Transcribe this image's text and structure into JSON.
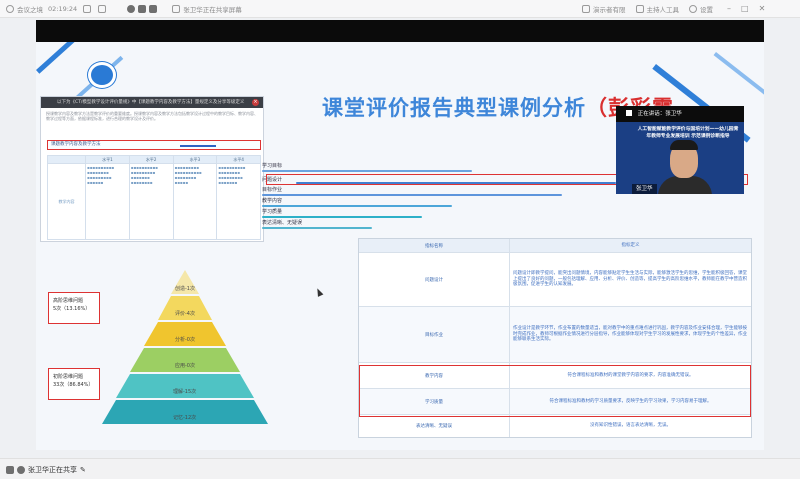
{
  "topbar": {
    "status_text": "会议之境",
    "time_text": "02:19:24",
    "sharing_text": "张卫华正在共享屏幕",
    "menu_items": [
      "演示者有限",
      "主持人工具",
      "设置"
    ]
  },
  "slide": {
    "title": "课堂评价报告典型课例分析",
    "title_paren_open": "（",
    "title_name": "彭彩霞"
  },
  "document": {
    "header": "以下为《CT/模型教学设计评价量规》中【课题教学内容及教学方法】量规定义及分享等级定义",
    "paragraph": "授课教学内容及教学方法是教学评价的重要维度。授课教学内容及教学方法包括教学设计过程中的教学目标、教学内容、教学过程等方面，依据课程标准，进行合理的教学设计及评价。",
    "banner": "课题教学内容及教学方法",
    "columns": [
      "",
      "水平1",
      "水平2",
      "水平3",
      "水平4"
    ],
    "row_label": "教学内容"
  },
  "labels": {
    "high_order_title": "高阶思维问题",
    "high_order_value": "5次（13.16%）",
    "low_order_title": "初阶思维问题",
    "low_order_value": "33次（86.84%）"
  },
  "pyramid": [
    {
      "label": "创造-1次",
      "color": "#f5e7a9"
    },
    {
      "label": "评价-4次",
      "color": "#f3d85e"
    },
    {
      "label": "分析-0次",
      "color": "#f0c52e"
    },
    {
      "label": "应用-0次",
      "color": "#9ccf63"
    },
    {
      "label": "理解-15次",
      "color": "#4fc3c4"
    },
    {
      "label": "记忆-12次",
      "color": "#2ca6b4"
    }
  ],
  "criteria": [
    {
      "label": "学习目标",
      "color": "#6aa3e0",
      "highlight": false
    },
    {
      "label": "问题设计",
      "color": "#3f7fd1",
      "highlight": true
    },
    {
      "label": "目标作业",
      "color": "#5d95dc",
      "highlight": false
    },
    {
      "label": "教学内容",
      "color": "#4ca6d9",
      "highlight": false
    },
    {
      "label": "学习质量",
      "color": "#2db0c8",
      "highlight": false
    },
    {
      "label": "表达清晰、无疑误",
      "color": "#52b5cf",
      "highlight": false
    }
  ],
  "table": {
    "header_left": "指标名称",
    "header_right": "指标定义",
    "rows": [
      {
        "name": "问题设计",
        "def": "问题设计即教学提问，能突出问题情境，内容能够贴近学生生活与实际，能够激活学生的思维，学生能积极回答，课堂上提出了良好的问题，一般包括理解、应用、分析、评价、创造等，提高学生的高阶思维水平，教师能在教学中营造积极氛围，促进学生的认知发展。"
      },
      {
        "name": "目标作业",
        "def": "作业设计是教学环节，作业布置的数量适当，能对教学中的重点难点进行巩固，教学内容及作业安排合理，学生能够按时完成作业，教师可根据作业情况进行分层指导，作业能够体现对学生学习的发展性要求，体现学生的个性差异，作业能够联系生活实际。"
      },
      {
        "name": "教学内容",
        "def": "符合课程标准和教材的课堂教学内容的要求，内容准确无错误。"
      },
      {
        "name": "学习质量",
        "def": "符合课程标准和教材的学习质量要求，反映学生的学习效果，学习内容易于理解。"
      },
      {
        "name": "表达清晰、无疑误",
        "def": "没有知识性错误，语言表达清晰，无误。"
      }
    ]
  },
  "video": {
    "top_label": "正在讲话：张卫华",
    "caption": "人工智能赋能教学评价与国培计划——幼儿园青年教师专业发展培训 示范课例诊断指导",
    "name_tag": "张卫华"
  },
  "bottombar": {
    "share_status": "张卫华正在共享"
  }
}
